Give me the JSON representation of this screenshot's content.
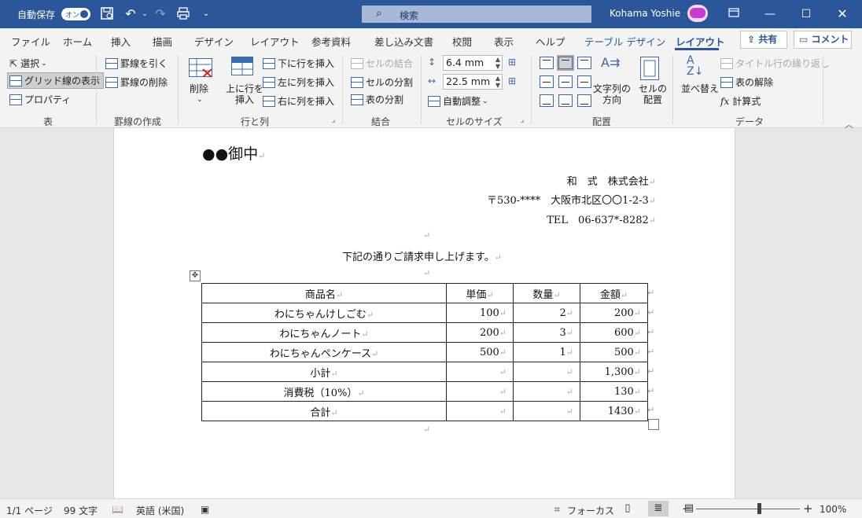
{
  "titlebar": {
    "autosave_label": "自動保存",
    "autosave_toggle": "オン",
    "search_placeholder": "検索",
    "user_name": "Kohama Yoshie"
  },
  "tabs": [
    "ファイル",
    "ホーム",
    "挿入",
    "描画",
    "デザイン",
    "レイアウト",
    "参考資料",
    "差し込み文書",
    "校閲",
    "表示",
    "ヘルプ"
  ],
  "context_tabs": [
    "テーブル デザイン",
    "レイアウト"
  ],
  "share_label": "共有",
  "comment_label": "コメント",
  "ribbon": {
    "table_group": {
      "label": "表",
      "select": "選択",
      "gridlines": "グリッド線の表示",
      "properties": "プロパティ"
    },
    "draw_group": {
      "label": "罫線の作成",
      "draw_borders": "罫線を引く",
      "eraser": "罫線の削除"
    },
    "rowscols_group": {
      "label": "行と列",
      "delete": "削除",
      "insert_above_1": "上に行を",
      "insert_above_2": "挿入",
      "insert_below": "下に行を挿入",
      "insert_left": "左に列を挿入",
      "insert_right": "右に列を挿入"
    },
    "merge_group": {
      "label": "結合",
      "merge_cells": "セルの結合",
      "split_cells": "セルの分割",
      "split_table": "表の分割"
    },
    "cellsize_group": {
      "label": "セルのサイズ",
      "height": "6.4 mm",
      "width": "22.5 mm",
      "autofit": "自動調整"
    },
    "align_group": {
      "label": "配置",
      "text_direction_1": "文字列の",
      "text_direction_2": "方向",
      "cell_margins_1": "セルの",
      "cell_margins_2": "配置"
    },
    "data_group": {
      "label": "データ",
      "sort": "並べ替え",
      "repeat_header": "タイトル行の繰り返し",
      "convert_to_text": "表の解除",
      "formula": "計算式"
    }
  },
  "document": {
    "addressee": "●●御中",
    "company": "和　式　株式会社",
    "address": "〒530-****　大阪市北区〇〇1-2-3",
    "tel": "TEL　06-637*-8282",
    "greeting": "下記の通りご請求申し上げます。",
    "table": {
      "headers": [
        "商品名",
        "単価",
        "数量",
        "金額"
      ],
      "rows": [
        [
          "わにちゃんけしごむ",
          "100",
          "2",
          "200"
        ],
        [
          "わにちゃんノート",
          "200",
          "3",
          "600"
        ],
        [
          "わにちゃんペンケース",
          "500",
          "1",
          "500"
        ],
        [
          "小計",
          "",
          "",
          "1,300"
        ],
        [
          "消費税（10%）",
          "",
          "",
          "130"
        ],
        [
          "合計",
          "",
          "",
          "1430"
        ]
      ]
    }
  },
  "statusbar": {
    "page": "1/1 ページ",
    "words": "99 文字",
    "language": "英語 (米国)",
    "focus": "フォーカス",
    "zoom": "100%"
  }
}
